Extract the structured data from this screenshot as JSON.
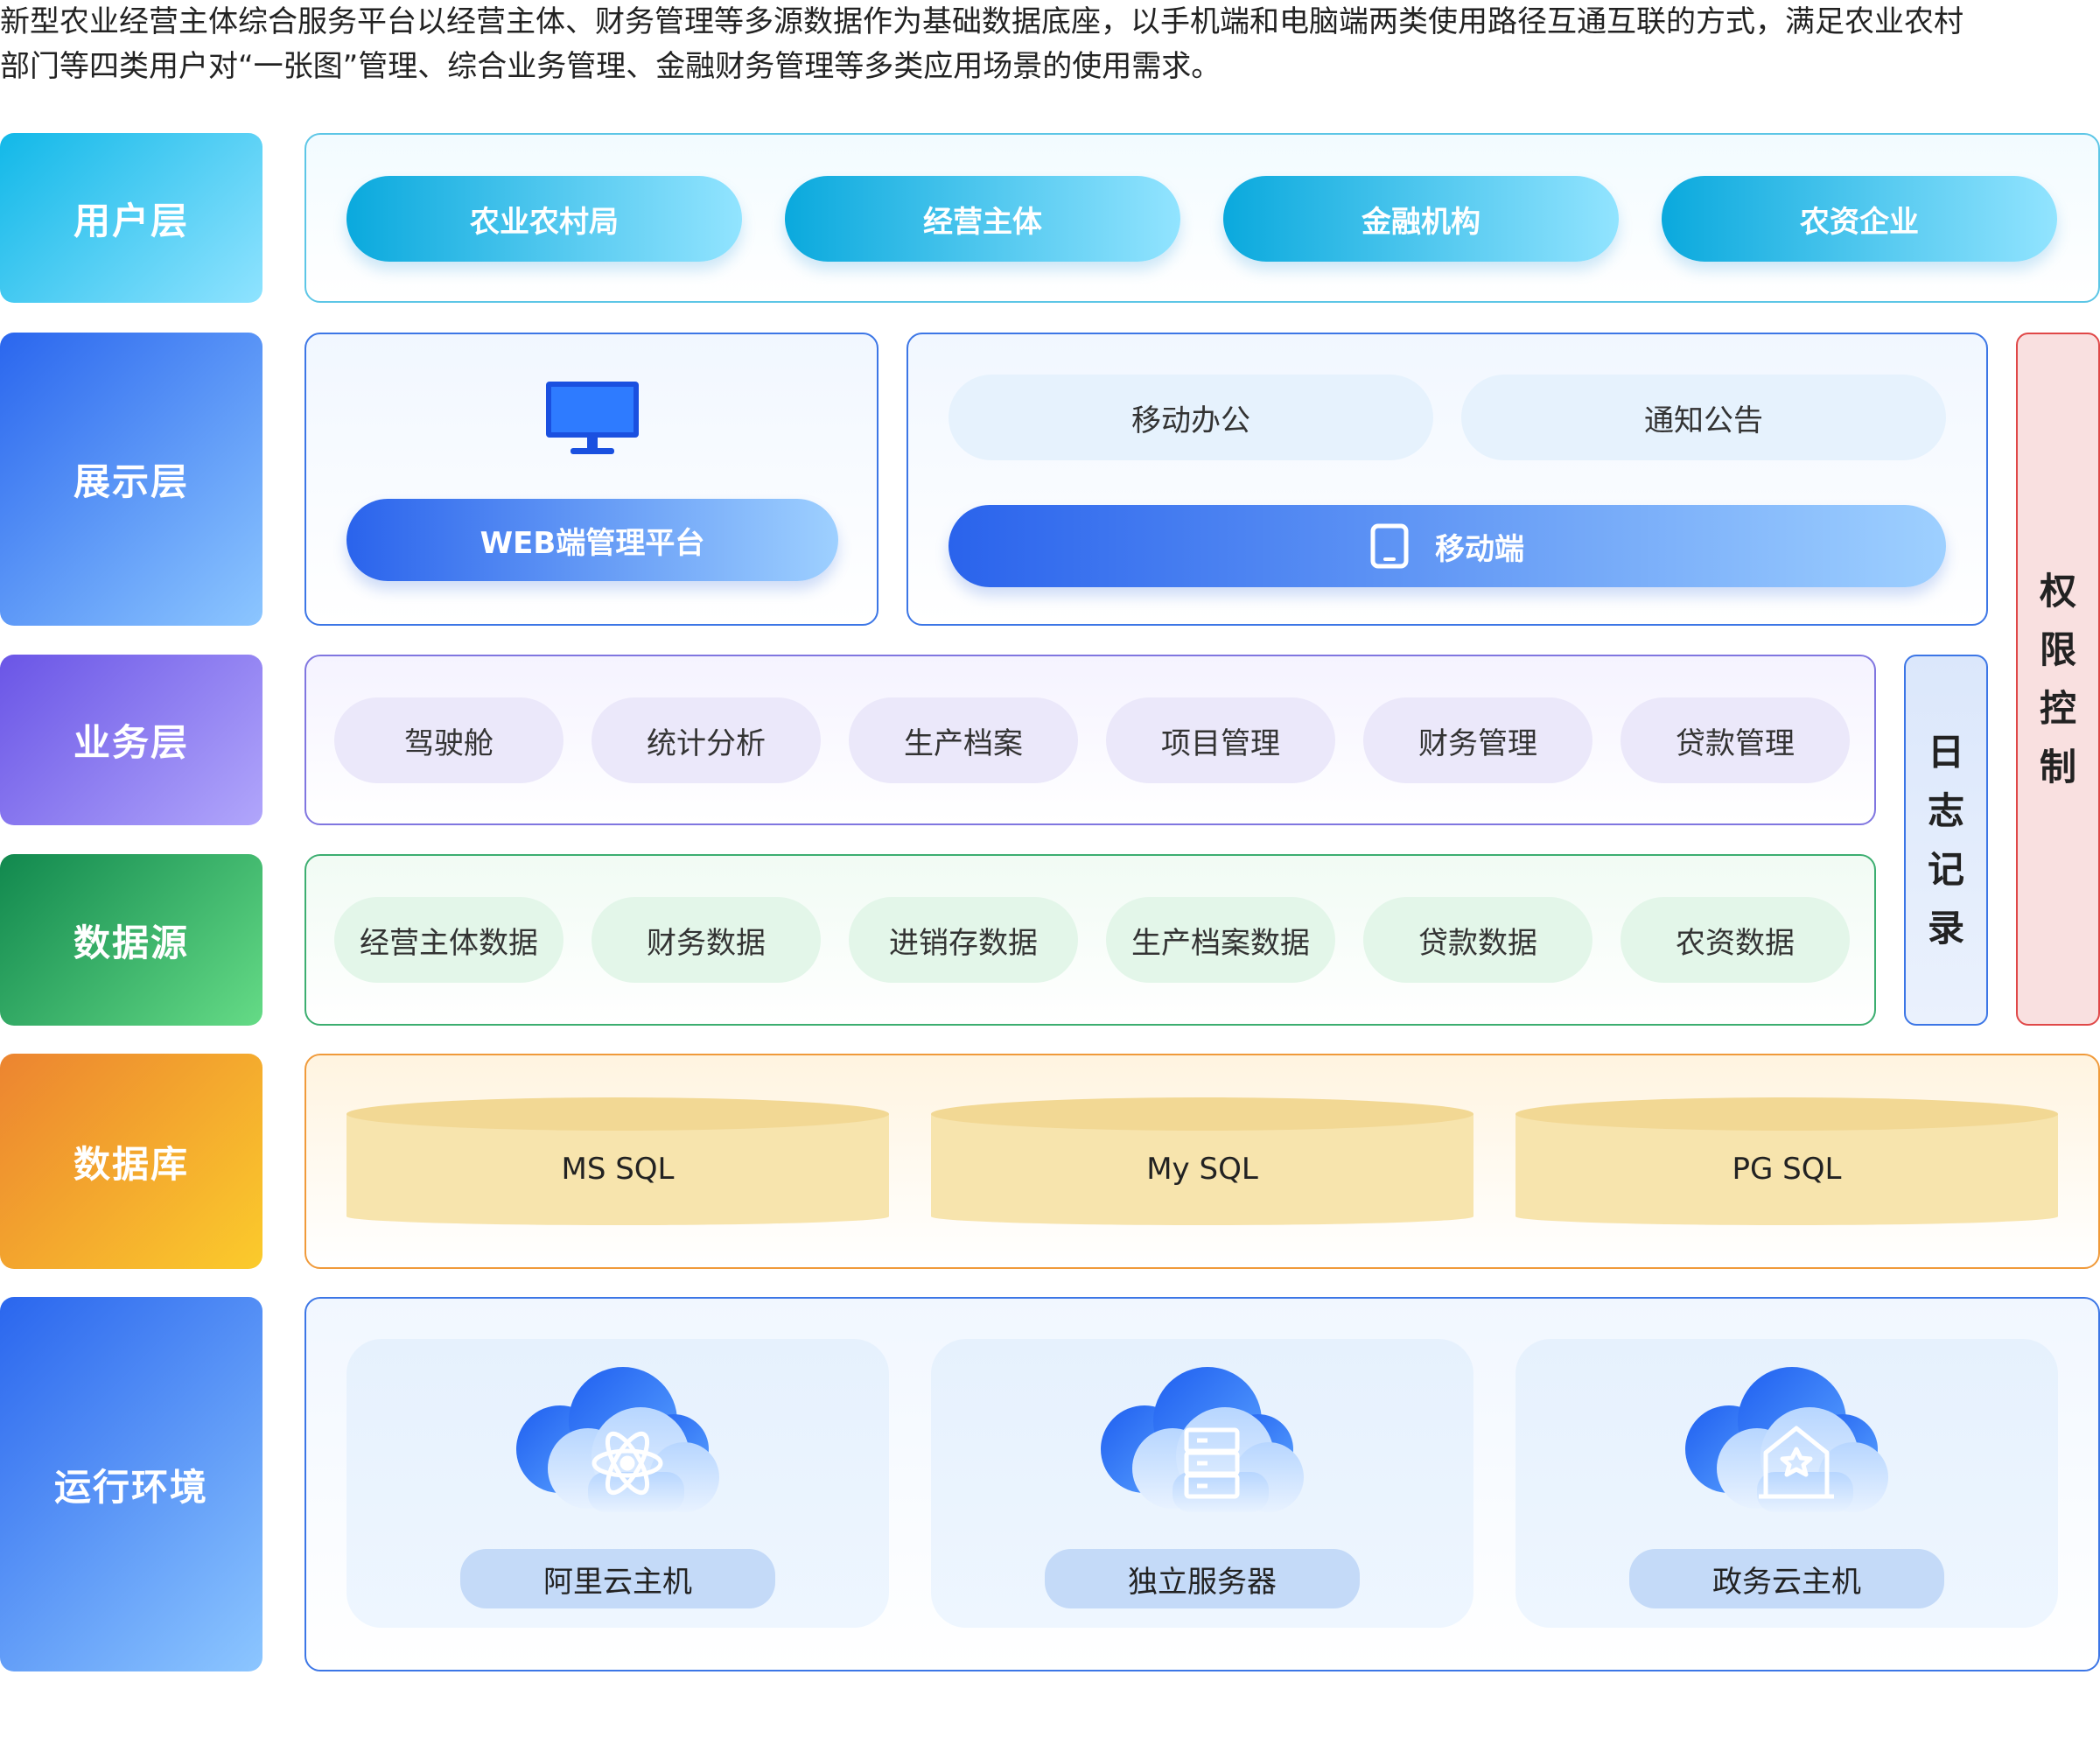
{
  "intro": {
    "line1": "新型农业经营主体综合服务平台以经营主体、财务管理等多源数据作为基础数据底座，以手机端和电脑端两类使用路径互通互联的方式，满足农业农村",
    "line2": "部门等四类用户对“一张图”管理、综合业务管理、金融财务管理等多类应用场景的使用需求。"
  },
  "layers": {
    "user": "用户层",
    "show": "展示层",
    "biz": "业务层",
    "src": "数据源",
    "db": "数据库",
    "env": "运行环境"
  },
  "user_items": [
    "农业农村局",
    "经营主体",
    "金融机构",
    "农资企业"
  ],
  "display": {
    "web_label": "WEB端管理平台",
    "mobile_office": "移动办公",
    "notice": "通知公告",
    "mobile_label": "移动端",
    "web_icon": "monitor-icon",
    "mobile_icon": "tablet-icon"
  },
  "biz_items": [
    "驾驶舱",
    "统计分析",
    "生产档案",
    "项目管理",
    "财务管理",
    "贷款管理"
  ],
  "src_items": [
    "经营主体数据",
    "财务数据",
    "进销存数据",
    "生产档案数据",
    "贷款数据",
    "农资数据"
  ],
  "databases": [
    "MS SQL",
    "My SQL",
    "PG SQL"
  ],
  "environments": [
    {
      "label": "阿里云主机",
      "icon": "cloud-atom-icon"
    },
    {
      "label": "独立服务器",
      "icon": "cloud-server-icon"
    },
    {
      "label": "政务云主机",
      "icon": "cloud-government-icon"
    }
  ],
  "log_label": "日志记录",
  "auth_label": "权限控制",
  "colors": {
    "user": "#12b8e8",
    "show": "#2a66ee",
    "biz": "#6a55e6",
    "src": "#11884e",
    "db": "#ec8430",
    "log_border": "#3c76e6",
    "auth_border": "#e04848"
  }
}
